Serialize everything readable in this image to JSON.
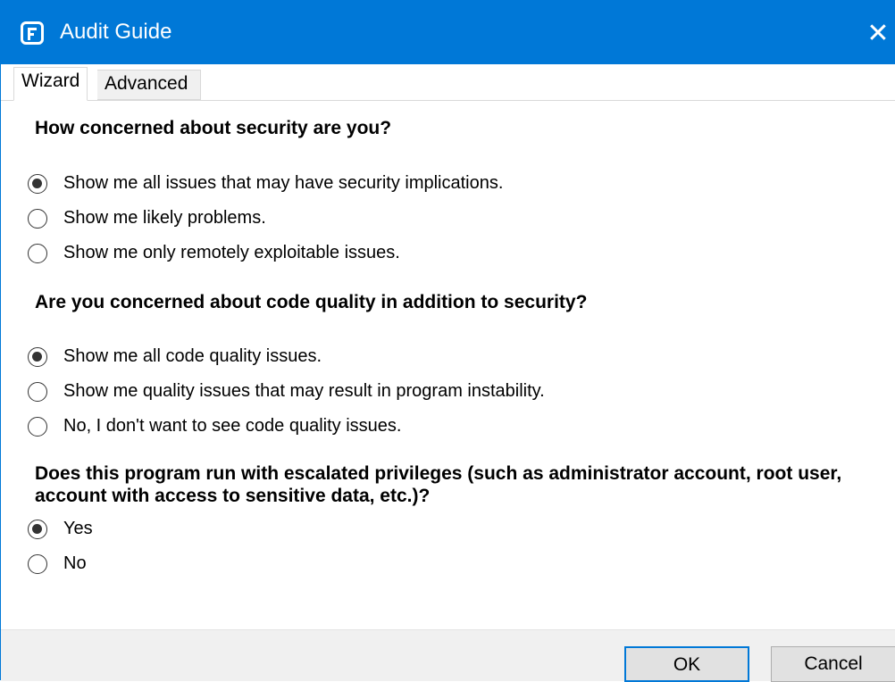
{
  "window": {
    "title": "Audit Guide",
    "close_glyph": "✕"
  },
  "tabs": [
    {
      "label": "Wizard",
      "selected": true
    },
    {
      "label": "Advanced",
      "selected": false
    }
  ],
  "questions": [
    {
      "text": "How concerned about security are you?",
      "options": [
        {
          "label": "Show me all issues that may have security implications.",
          "checked": true
        },
        {
          "label": "Show me likely problems.",
          "checked": false
        },
        {
          "label": "Show me only remotely exploitable issues.",
          "checked": false
        }
      ]
    },
    {
      "text": "Are you concerned about code quality in addition to security?",
      "options": [
        {
          "label": "Show me all code quality issues.",
          "checked": true
        },
        {
          "label": "Show me quality issues that may result in program instability.",
          "checked": false
        },
        {
          "label": "No, I don't want to see code quality issues.",
          "checked": false
        }
      ]
    },
    {
      "text": "Does this program run with escalated privileges (such as administrator account, root user, account with access to sensitive data, etc.)?",
      "options": [
        {
          "label": "Yes",
          "checked": true
        },
        {
          "label": "No",
          "checked": false
        }
      ]
    }
  ],
  "buttons": {
    "ok": "OK",
    "cancel": "Cancel"
  },
  "colors": {
    "accent": "#0078d7",
    "footer": "#f0f0f0"
  }
}
